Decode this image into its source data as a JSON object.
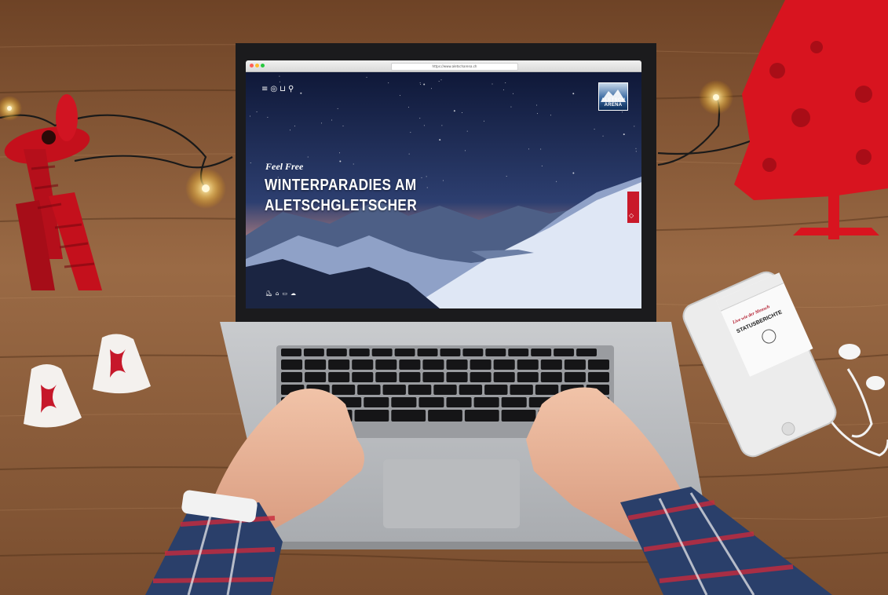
{
  "photo": {
    "description_free": true
  },
  "laptop_screen": {
    "browser": {
      "url": "https://www.aletscharena.ch"
    },
    "website": {
      "nav_icons": [
        "menu-icon",
        "user-icon",
        "cart-icon",
        "search-icon"
      ],
      "logo_text": "ALETSCH ARENA",
      "tagline": "Feel Free",
      "headline_line1": "WINTERPARADIES AM",
      "headline_line2": "ALETSCHGLETSCHER",
      "side_tab_icon": "tag-icon",
      "bottom_icons": [
        "lift-icon",
        "house-icon",
        "camera-icon",
        "weather-icon"
      ]
    }
  },
  "phone_screen": {
    "tagline": "Live wie der Mensch",
    "heading": "STATUSBERICHTE"
  },
  "colors": {
    "accent_red": "#c9192a",
    "wood": "#8a5a37",
    "night_sky": "#1c2a52"
  }
}
